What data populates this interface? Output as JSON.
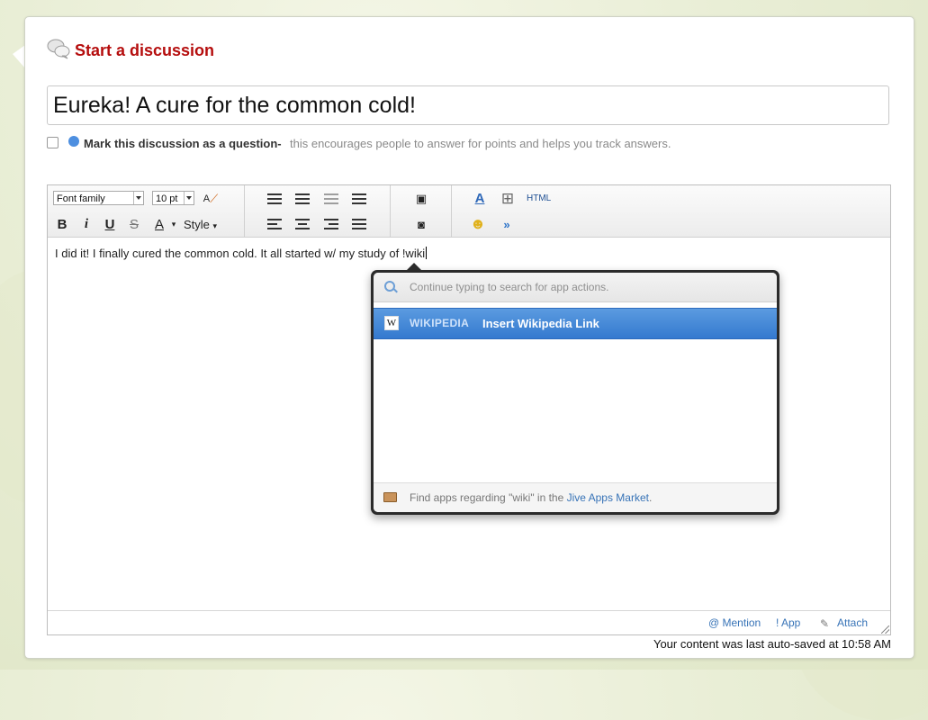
{
  "header": {
    "title": "Start a discussion"
  },
  "subject": {
    "value": "Eureka! A cure for the common cold!"
  },
  "question": {
    "label": "Mark this discussion as a question-",
    "hint": "this encourages people to answer for points and helps you track answers."
  },
  "toolbar": {
    "font_family": "Font family",
    "font_size": "10 pt",
    "style_label": "Style",
    "html_label": "HTML",
    "bold": "B",
    "italic": "i",
    "underline": "U",
    "strike": "S",
    "font_color": "A"
  },
  "editor": {
    "text": "I did it! I finally cured the common cold. It all started w/ my study of !wiki"
  },
  "popup": {
    "search_placeholder": "Continue typing to search for app actions.",
    "result": {
      "app": "WIKIPEDIA",
      "action": "Insert Wikipedia Link",
      "logo": "W"
    },
    "footer_text": "Find apps regarding \"wiki\" in the ",
    "footer_link": "Jive Apps Market",
    "footer_end": "."
  },
  "footer": {
    "mention": "@ Mention",
    "app": "! App",
    "attach": "Attach"
  },
  "status": {
    "autosave": "Your content was last auto-saved at 10:58 AM"
  },
  "colors": {
    "title": "#b50d0d",
    "link": "#3773b7",
    "highlight": "#3479cf"
  }
}
